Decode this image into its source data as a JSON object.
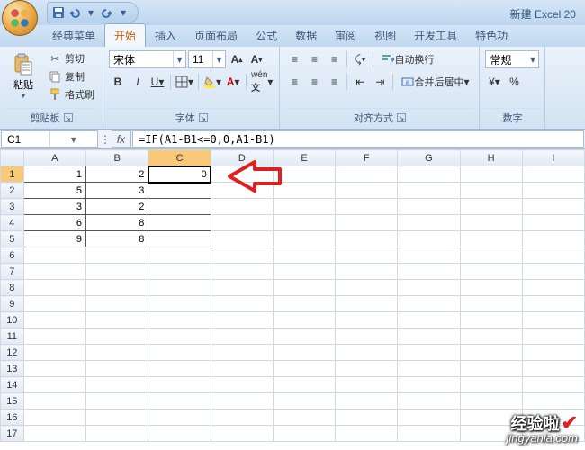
{
  "app": {
    "title": "新建 Excel 20"
  },
  "qat": {
    "save": "save-icon",
    "undo": "undo-icon",
    "redo": "redo-icon",
    "more": "chevron-down-icon"
  },
  "tabs": [
    "经典菜单",
    "开始",
    "插入",
    "页面布局",
    "公式",
    "数据",
    "审阅",
    "视图",
    "开发工具",
    "特色功"
  ],
  "active_tab": 1,
  "clipboard": {
    "paste": "粘贴",
    "cut": "剪切",
    "copy": "复制",
    "painter": "格式刷",
    "group": "剪贴板"
  },
  "font": {
    "family": "宋体",
    "size": "11",
    "bold": "B",
    "italic": "I",
    "underline": "U",
    "group": "字体"
  },
  "align": {
    "wrap": "自动换行",
    "merge": "合并后居中",
    "group": "对齐方式"
  },
  "number": {
    "format": "常规",
    "group": "数字"
  },
  "namebox": "C1",
  "fx_label": "fx",
  "formula": "=IF(A1-B1<=0,0,A1-B1)",
  "columns": [
    "A",
    "B",
    "C",
    "D",
    "E",
    "F",
    "G",
    "H",
    "I"
  ],
  "rows": 17,
  "selected": {
    "row": 1,
    "col": "C",
    "display": "0"
  },
  "cells": {
    "1": {
      "A": "1",
      "B": "2",
      "C": "0"
    },
    "2": {
      "A": "5",
      "B": "3"
    },
    "3": {
      "A": "3",
      "B": "2"
    },
    "4": {
      "A": "6",
      "B": "8"
    },
    "5": {
      "A": "9",
      "B": "8"
    }
  },
  "data_region_cols": [
    "A",
    "B",
    "C"
  ],
  "watermark": {
    "text": "经验啦",
    "url": "jingyanla.com"
  }
}
